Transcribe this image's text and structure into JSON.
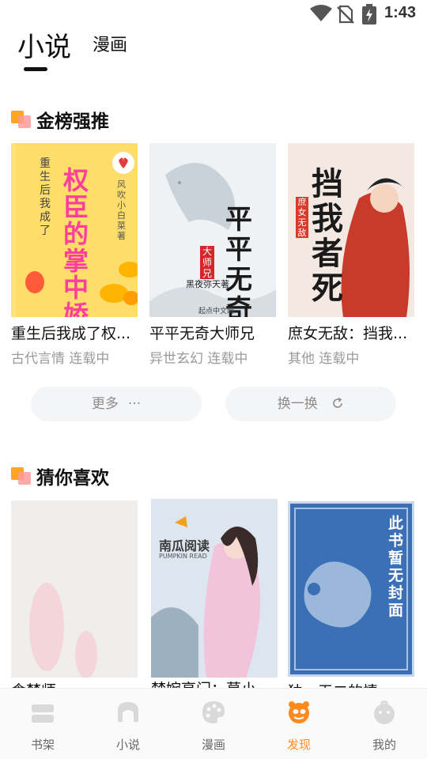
{
  "status_bar": {
    "time": "1:43"
  },
  "top_tabs": {
    "novel": "小说",
    "comic": "漫画"
  },
  "golden": {
    "title": "金榜强推",
    "books": [
      {
        "title": "重生后我成了权...",
        "category": "古代言情",
        "status": "连载中",
        "cover_text": "权臣的掌中娇",
        "cover_sub": "重生后我成了",
        "cover_author": "风吹小白菜 著"
      },
      {
        "title": "平平无奇大师兄",
        "category": "异世玄幻",
        "status": "连载中",
        "cover_text": "平平无奇",
        "cover_sub": "大师兄",
        "cover_author": "黑夜弥天著",
        "cover_pub": "起点中文网"
      },
      {
        "title": "庶女无敌：挡我...",
        "category": "其他",
        "status": "连载中",
        "cover_text": "挡我者死",
        "cover_sub": "庶女无敌"
      }
    ],
    "more_label": "更多",
    "refresh_label": "换一换"
  },
  "guess": {
    "title": "猜你喜欢",
    "books": [
      {
        "title": "食梦师"
      },
      {
        "title": "梦婉亭门：莫小...",
        "cover_text": "南瓜阅读",
        "cover_sub": "PUMPKIN READ"
      },
      {
        "title": "独一无二的情...",
        "cover_text": "此书暂无封面"
      }
    ]
  },
  "bottom_nav": {
    "items": [
      {
        "label": "书架",
        "icon": "bookshelf-icon"
      },
      {
        "label": "小说",
        "icon": "novel-icon"
      },
      {
        "label": "漫画",
        "icon": "palette-icon"
      },
      {
        "label": "发现",
        "icon": "discover-icon",
        "active": true
      },
      {
        "label": "我的",
        "icon": "profile-icon"
      }
    ]
  },
  "colors": {
    "accent": "#ff8a1f",
    "section_mark": "#ffa522"
  }
}
